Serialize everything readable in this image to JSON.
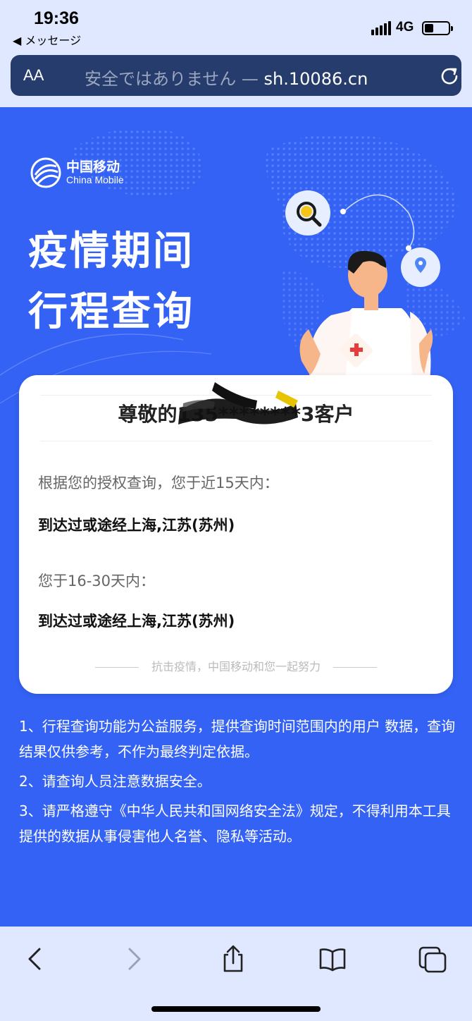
{
  "status_bar": {
    "time": "19:36",
    "back_label": "◀ メッセージ",
    "network": "4G"
  },
  "url_bar": {
    "text_size_label": "AA",
    "security_prefix": "安全ではありません — ",
    "host": "sh.10086.cn"
  },
  "page": {
    "logo_cn": "中国移动",
    "logo_en": "China Mobile",
    "headline_line1": "疫情期间",
    "headline_line2": "行程查询",
    "card": {
      "title": "尊敬的135********3客户",
      "q1": "根据您的授权查询，您于近15天内：",
      "a1": "到达过或途经上海,江苏(苏州)",
      "q2": "您于16-30天内：",
      "a2": "到达过或途经上海,江苏(苏州)",
      "slogan": "抗击疫情，中国移动和您一起努力"
    },
    "notes": [
      "1、行程查询功能为公益服务，提供查询时间范围内的用户 数据，查询结果仅供参考，不作为最终判定依据。",
      "2、请查询人员注意数据安全。",
      "3、请严格遵守《中华人民共和国网络安全法》规定，不得利用本工具提供的数据从事侵害他人名誉、隐私等活动。"
    ]
  },
  "toolbar": {
    "icons": [
      "back-icon",
      "forward-icon",
      "share-icon",
      "bookmarks-icon",
      "tabs-icon"
    ]
  },
  "colors": {
    "page_blue": "#3462f4",
    "chrome_bg": "#dfe8ff",
    "url_bar_bg": "#263c6c",
    "accent_red": "#e83b3b"
  }
}
